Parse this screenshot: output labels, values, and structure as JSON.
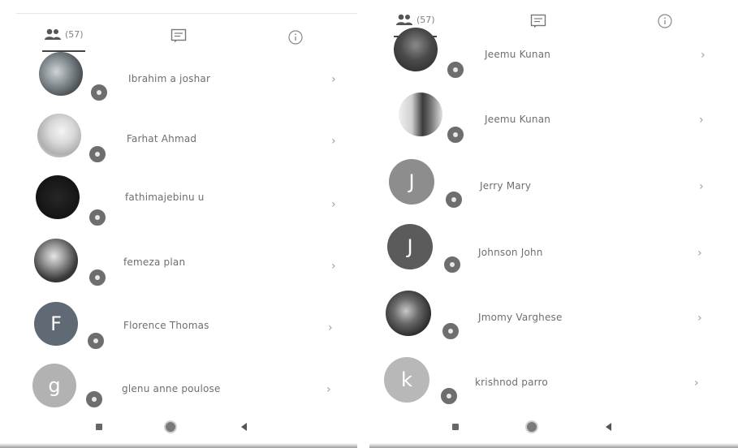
{
  "left": {
    "tabs": {
      "members_count": "(57)"
    },
    "contacts": [
      {
        "name": "Ibrahim a joshar",
        "avatar": "photo"
      },
      {
        "name": "Farhat Ahmad",
        "avatar": "photo"
      },
      {
        "name": "fathimajebinu u",
        "avatar": "photo"
      },
      {
        "name": "femeza plan",
        "avatar": "photo"
      },
      {
        "name": "Florence Thomas",
        "avatar": "letter",
        "initial": "F",
        "color": "#5f6a74"
      },
      {
        "name": "glenu anne poulose",
        "avatar": "letter",
        "initial": "g",
        "color": "#b2b2b2"
      }
    ]
  },
  "right": {
    "tabs": {
      "members_count": "(57)"
    },
    "contacts": [
      {
        "name": "Jeemu Kunan",
        "avatar": "photo"
      },
      {
        "name": "Jeemu Kunan",
        "avatar": "photo"
      },
      {
        "name": "Jerry Mary",
        "avatar": "letter",
        "initial": "J",
        "color": "#8d8d8d"
      },
      {
        "name": "Johnson John",
        "avatar": "letter",
        "initial": "J",
        "color": "#5b5b5b"
      },
      {
        "name": "Jmomy Varghese",
        "avatar": "photo"
      },
      {
        "name": "krishnod parro",
        "avatar": "letter",
        "initial": "k",
        "color": "#b8b8b8"
      }
    ]
  },
  "colors": {
    "badge": "#6e6e6e",
    "text": "#6e6e6e",
    "active_tab_underline": "#444444"
  },
  "icons": {
    "tabs": [
      "people-icon",
      "chat-icon",
      "info-icon"
    ],
    "row": [
      "status-badge-icon",
      "chevron-right-icon"
    ],
    "navbar": [
      "nav-square-icon",
      "nav-home-icon",
      "nav-back-icon"
    ]
  }
}
